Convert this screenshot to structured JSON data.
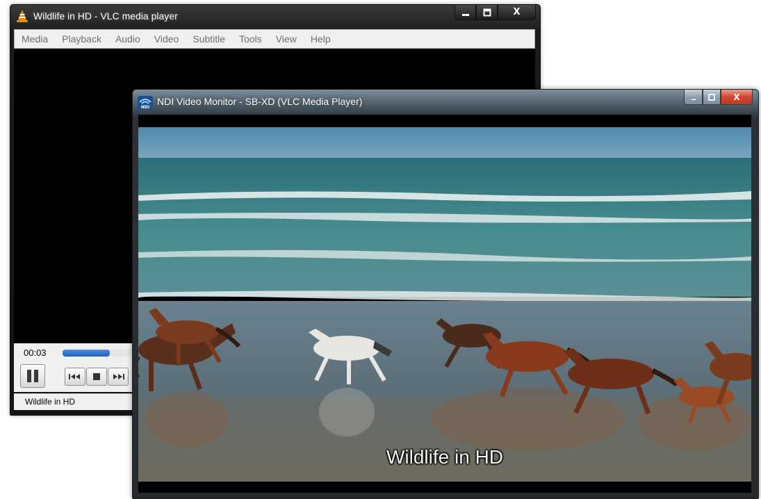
{
  "vlc": {
    "title": "Wildlife in HD - VLC media player",
    "caption": {
      "minimize": "▁",
      "maximize": "☐",
      "close": "X"
    },
    "menu": [
      "Media",
      "Playback",
      "Audio",
      "Video",
      "Subtitle",
      "Tools",
      "View",
      "Help"
    ],
    "time": "00:03",
    "progress": 0.4,
    "status": "Wildlife in HD",
    "colors": {
      "accent": "#1f5fbf",
      "menu_text": "#6d6d6d"
    }
  },
  "ndi": {
    "title": "NDI Video Monitor - SB-XD (VLC Media Player)",
    "caption": {
      "minimize": "▁",
      "maximize": "☐",
      "close": "X"
    },
    "icon_text": "NDI",
    "subtitle": "Wildlife in HD",
    "colors": {
      "close": "#c03a22",
      "sky": "#5f93b5",
      "sea": "#3c7d82",
      "sand": "#5f7480"
    }
  }
}
